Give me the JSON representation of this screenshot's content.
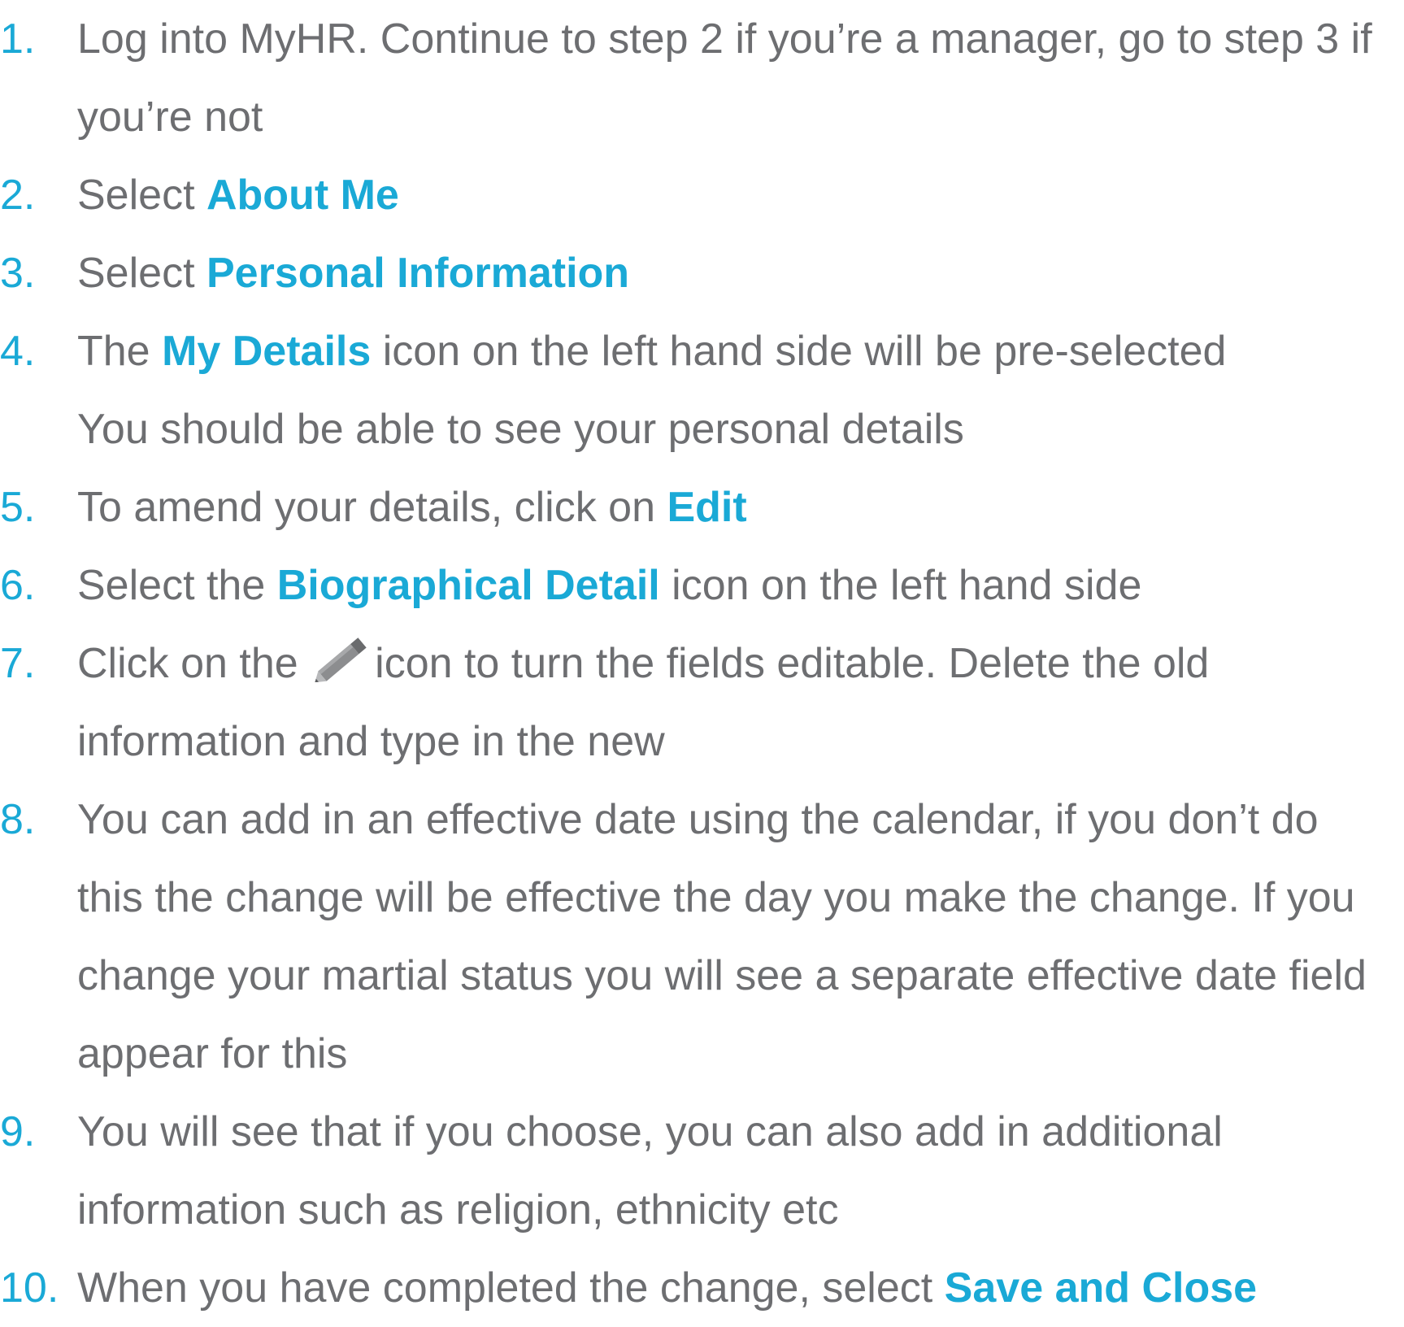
{
  "colors": {
    "accent": "#1aa9d6",
    "text": "#6d6e71"
  },
  "steps": [
    {
      "num": "1.",
      "line1": "Log into MyHR. Continue to step 2 if you’re a manager, go to step 3 if",
      "line2": "you’re not"
    },
    {
      "num": "2.",
      "pre": "Select ",
      "hl": "About Me"
    },
    {
      "num": "3.",
      "pre": "Select ",
      "hl": "Personal Information"
    },
    {
      "num": "4.",
      "pre": "The ",
      "hl": "My Details",
      "post": " icon on the left hand side will be pre-selected",
      "line2": "You should be able to see your personal details"
    },
    {
      "num": "5.",
      "pre": "To amend your details, click on ",
      "hl": "Edit"
    },
    {
      "num": "6.",
      "pre": "Select the ",
      "hl": "Biographical Detail",
      "post": " icon on the left hand side"
    },
    {
      "num": "7.",
      "pre": "Click on the ",
      "icon": "pencil-icon",
      "post": "icon to turn the fields editable. Delete the old",
      "line2": "information and type in the new"
    },
    {
      "num": "8.",
      "line1": "You can add in an effective date using the calendar, if you don’t do",
      "line2": "this the change will be effective the day you make the change. If you",
      "line3": "change your martial status you will see a separate effective date field",
      "line4": "appear for this"
    },
    {
      "num": "9.",
      "line1": "You will see that if you choose, you can also add in additional",
      "line2": "information such as religion, ethnicity etc"
    },
    {
      "num": "10.",
      "pre": "When you have completed the change, select ",
      "hl": "Save and Close"
    }
  ]
}
